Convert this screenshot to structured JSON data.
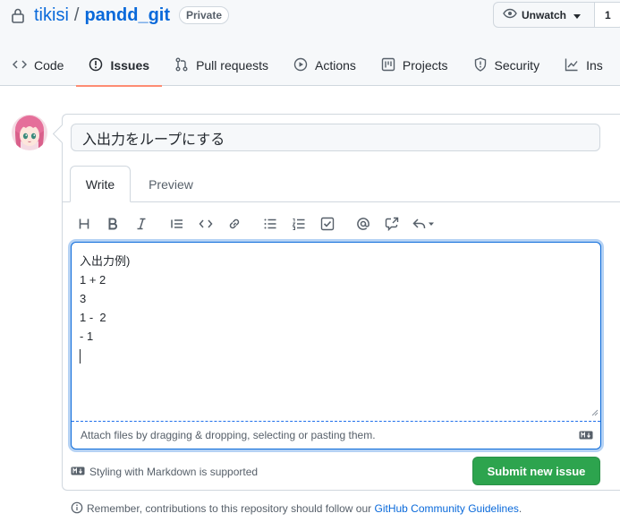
{
  "repo": {
    "owner": "tikisi",
    "separator": "/",
    "name": "pandd_git",
    "visibility_badge": "Private",
    "watch_label": "Unwatch",
    "watch_count": "1",
    "icons": {
      "lock": "lock-icon",
      "eye": "eye-icon",
      "caret": "triangle-down-icon"
    }
  },
  "nav": {
    "tabs": [
      {
        "label": "Code",
        "icon": "code-icon",
        "active": false
      },
      {
        "label": "Issues",
        "icon": "issue-opened-icon",
        "active": true
      },
      {
        "label": "Pull requests",
        "icon": "git-pull-request-icon",
        "active": false
      },
      {
        "label": "Actions",
        "icon": "play-icon",
        "active": false
      },
      {
        "label": "Projects",
        "icon": "project-icon",
        "active": false
      },
      {
        "label": "Security",
        "icon": "shield-icon",
        "active": false
      },
      {
        "label": "Ins",
        "icon": "graph-icon",
        "active": false
      }
    ]
  },
  "issue_form": {
    "title_value": "入出力をループにする",
    "tabs": {
      "write": "Write",
      "preview": "Preview"
    },
    "toolbar": [
      "heading-icon",
      "bold-icon",
      "italic-icon",
      "quote-icon",
      "code-icon",
      "link-icon",
      "unordered-list-icon",
      "ordered-list-icon",
      "task-list-icon",
      "mention-icon",
      "cross-reference-icon",
      "reply-icon"
    ],
    "body_lines": [
      "入出力例)",
      "1 + 2",
      "3",
      "1 -  2",
      "- 1"
    ],
    "attach_text": "Attach files by dragging & dropping, selecting or pasting them.",
    "markdown_note": "Styling with Markdown is supported",
    "submit_label": "Submit new issue"
  },
  "footer": {
    "text": "Remember, contributions to this repository should follow our",
    "link": "GitHub Community Guidelines",
    "end": "."
  },
  "colors": {
    "link": "#0969da",
    "active_tab_underline": "#fd8c73",
    "submit_green": "#2da44e",
    "focus_border": "#0969da",
    "header_bg": "#f6f8fa"
  }
}
